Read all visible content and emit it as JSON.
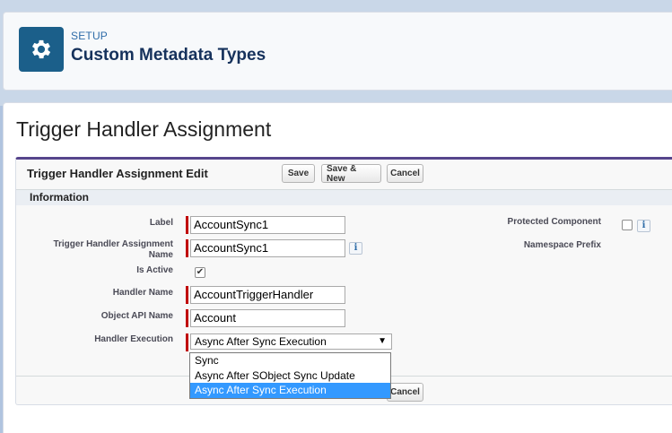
{
  "header": {
    "eyebrow": "SETUP",
    "title": "Custom Metadata Types",
    "icon": "gear-icon"
  },
  "record": {
    "title": "Trigger Handler Assignment"
  },
  "edit": {
    "title": "Trigger Handler Assignment Edit",
    "buttons": {
      "save": "Save",
      "save_new": "Save & New",
      "cancel": "Cancel"
    },
    "section": "Information",
    "fields": {
      "label": {
        "label": "Label",
        "value": "AccountSync1"
      },
      "name": {
        "label": "Trigger Handler Assignment Name",
        "value": "AccountSync1"
      },
      "is_active": {
        "label": "Is Active",
        "checked": true
      },
      "handler_name": {
        "label": "Handler Name",
        "value": "AccountTriggerHandler"
      },
      "object_api": {
        "label": "Object API Name",
        "value": "Account"
      },
      "handler_execution": {
        "label": "Handler Execution",
        "value": "Async After Sync Execution"
      },
      "protected": {
        "label": "Protected Component",
        "checked": false
      },
      "namespace": {
        "label": "Namespace Prefix",
        "value": ""
      }
    },
    "dropdown_options": [
      "Sync",
      "Async After SObject Sync Update",
      "Async After Sync Execution"
    ],
    "dropdown_selected_index": 2,
    "bottom_cancel": "Cancel"
  },
  "colors": {
    "required": "#c00000",
    "icon_bg": "#1b5f8a",
    "selected_option": "#3399ff"
  }
}
